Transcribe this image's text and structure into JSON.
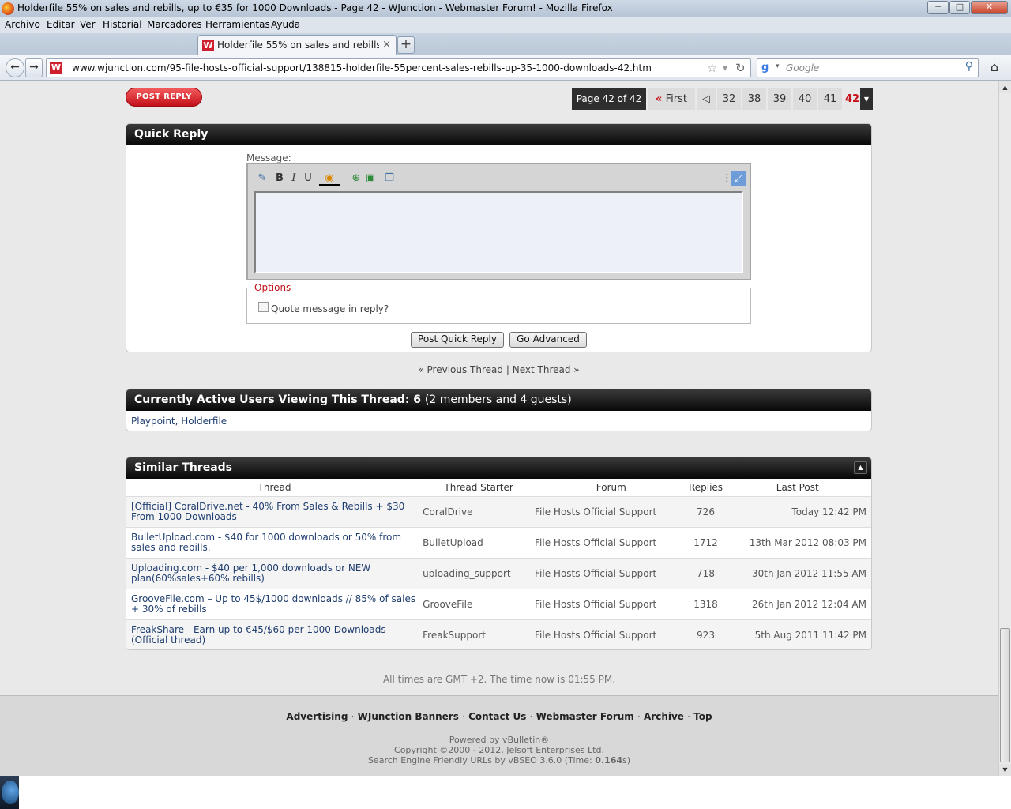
{
  "window": {
    "title": "Holderfile 55% on sales and rebills, up to €35 for 1000 Downloads - Page 42 - WJunction - Webmaster Forum! - Mozilla Firefox",
    "minimize": "─",
    "maximize": "□",
    "close": "✕"
  },
  "menu": [
    "Archivo",
    "Editar",
    "Ver",
    "Historial",
    "Marcadores",
    "Herramientas",
    "Ayuda"
  ],
  "tab": {
    "favicon": "W",
    "label": "Holderfile 55% on sales and rebills, u...",
    "close": "×",
    "new_tab": "+"
  },
  "nav": {
    "back": "←",
    "forward": "→",
    "site_icon": "W",
    "url": "www.wjunction.com/95-file-hosts-official-support/138815-holderfile-55percent-sales-rebills-up-35-1000-downloads-42.htm",
    "bookmark_star": "☆",
    "dropdown": "▾",
    "reload": "↻",
    "search_engine_icon": "g",
    "search_dropdown": "▾",
    "search_placeholder": "Google",
    "search_icon": "⚲",
    "home_icon": "⌂"
  },
  "page": {
    "post_reply": "POST REPLY",
    "pagination": {
      "info": "Page 42 of 42",
      "first": "« First",
      "prev": "◁",
      "pages": [
        "32",
        "38",
        "39",
        "40",
        "41"
      ],
      "current": "42",
      "menu": "▼"
    },
    "quick_reply": {
      "title": "Quick Reply",
      "message_label": "Message:",
      "toolbar": {
        "switch_mode": "✎",
        "bold": "B",
        "italic": "I",
        "underline": "U",
        "color": "◉",
        "link": "⊕",
        "image": "▣",
        "quote": "❐",
        "resize": "⋮",
        "expand": "⤢"
      },
      "options_legend": "Options",
      "quote_checkbox_label": "Quote message in reply?",
      "post_button": "Post Quick Reply",
      "advanced_button": "Go Advanced"
    },
    "thread_nav": {
      "prev": "« Previous Thread",
      "sep": "|",
      "next": "Next Thread »"
    },
    "active_users": {
      "title_prefix": "Currently Active Users Viewing This Thread: 6",
      "title_suffix": "(2 members and 4 guests)",
      "users": "Playpoint, Holderfile"
    },
    "similar": {
      "title": "Similar Threads",
      "collapse": "▲",
      "headers": [
        "Thread",
        "Thread Starter",
        "Forum",
        "Replies",
        "Last Post"
      ],
      "rows": [
        {
          "thread": "[Official] CoralDrive.net - 40% From Sales & Rebills + $30 From 1000 Downloads",
          "starter": "CoralDrive",
          "forum": "File Hosts Official Support",
          "replies": "726",
          "last": "Today 12:42 PM"
        },
        {
          "thread": "BulletUpload.com - $40 for 1000 downloads or 50% from sales and rebills.",
          "starter": "BulletUpload",
          "forum": "File Hosts Official Support",
          "replies": "1712",
          "last": "13th Mar 2012 08:03 PM"
        },
        {
          "thread": "Uploading.com - $40 per 1,000 downloads or NEW plan(60%sales+60% rebills)",
          "starter": "uploading_support",
          "forum": "File Hosts Official Support",
          "replies": "718",
          "last": "30th Jan 2012 11:55 AM"
        },
        {
          "thread": "GrooveFile.com – Up to 45$/1000 downloads // 85% of sales + 30% of rebills",
          "starter": "GrooveFile",
          "forum": "File Hosts Official Support",
          "replies": "1318",
          "last": "26th Jan 2012 12:04 AM"
        },
        {
          "thread": "FreakShare - Earn up to €45/$60 per 1000 Downloads (Official thread)",
          "starter": "FreakSupport",
          "forum": "File Hosts Official Support",
          "replies": "923",
          "last": "5th Aug 2011 11:42 PM"
        }
      ]
    },
    "gmt": "All times are GMT +2. The time now is 01:55 PM.",
    "footer_links": [
      "Advertising",
      "WJunction Banners",
      "Contact Us",
      "Webmaster Forum",
      "Archive",
      "Top"
    ],
    "footer_sep": "·",
    "powered": "Powered by vBulletin®",
    "copyright": "Copyright ©2000 - 2012, Jelsoft Enterprises Ltd.",
    "seo_prefix": "Search Engine Friendly URLs by vBSEO 3.6.0 (Time: ",
    "seo_time": "0.164",
    "seo_suffix": "s)"
  },
  "scrollbar": {
    "up": "▲",
    "down": "▼"
  },
  "colors": {
    "accent": "#c4101a",
    "header_bg": "#111111",
    "link": "#1e3d6e"
  }
}
